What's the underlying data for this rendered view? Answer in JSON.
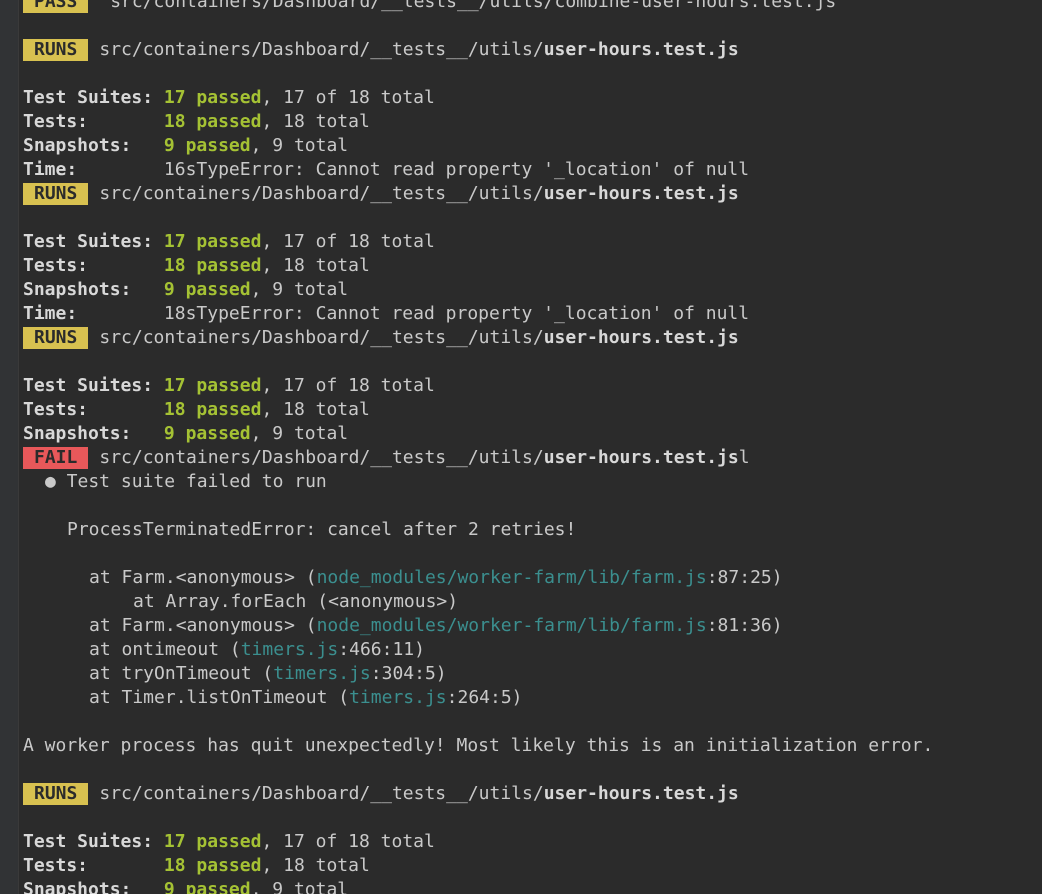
{
  "colors": {
    "background": "#2b2b2b",
    "text": "#c9c9c9",
    "passed_green": "#a5c234",
    "runs_badge": "#d8c150",
    "fail_badge": "#e8585a",
    "link_teal": "#3b8f8f"
  },
  "header_partial": {
    "badge": "PASS",
    "path": " src/containers/Dashboard/__tests__/utils/combine-user-hours.test.js"
  },
  "badges": {
    "runs": "RUNS",
    "fail": "FAIL"
  },
  "test_path_prefix": "src/containers/Dashboard/__tests__/utils/",
  "test_file": "user-hours.test.js",
  "test_file_trailing": "l",
  "labels": {
    "suites": "Test Suites:",
    "tests": "Tests:",
    "snapshots": "Snapshots:",
    "time": "Time:"
  },
  "summary": {
    "suites_passed": "17 passed",
    "suites_rest": ", 17 of 18 total",
    "tests_passed": "18 passed",
    "tests_rest": ", 18 total",
    "snapshots_passed": "9 passed",
    "snapshots_rest": ", 9 total"
  },
  "time_lines": [
    "16sTypeError: Cannot read property '_location' of null",
    "18sTypeError: Cannot read property '_location' of null"
  ],
  "failure": {
    "bullet": "● Test suite failed to run",
    "error": "ProcessTerminatedError: cancel after 2 retries!",
    "stack": [
      {
        "pre": "at Farm.<anonymous> (",
        "file": "node_modules/worker-farm/lib/farm.js",
        "post": ":87:25)"
      },
      {
        "pre": "at Array.forEach (<anonymous>)",
        "file": "",
        "post": ""
      },
      {
        "pre": "at Farm.<anonymous> (",
        "file": "node_modules/worker-farm/lib/farm.js",
        "post": ":81:36)"
      },
      {
        "pre": "at ontimeout (",
        "file": "timers.js",
        "post": ":466:11)"
      },
      {
        "pre": "at tryOnTimeout (",
        "file": "timers.js",
        "post": ":304:5)"
      },
      {
        "pre": "at Timer.listOnTimeout (",
        "file": "timers.js",
        "post": ":264:5)"
      }
    ]
  },
  "worker_message": "A worker process has quit unexpectedly! Most likely this is an initialization error."
}
